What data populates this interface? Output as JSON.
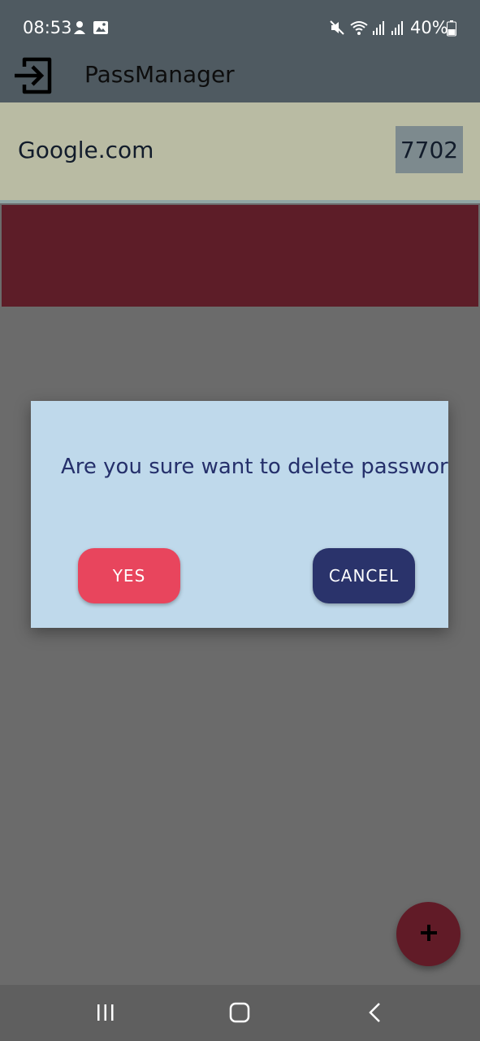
{
  "status_bar": {
    "time": "08:53",
    "battery": "40%",
    "icons": [
      "notification-icon",
      "gallery-icon",
      "mute-icon",
      "wifi-icon",
      "signal-icon",
      "signal-icon",
      "battery-icon"
    ]
  },
  "app_bar": {
    "title": "PassManager",
    "leading_icon": "exit-icon"
  },
  "list": {
    "items": [
      {
        "site": "Google.com",
        "pin": "7702"
      }
    ]
  },
  "dialog": {
    "message": "Are you sure want to delete password",
    "yes_label": "YES",
    "cancel_label": "CANCEL"
  },
  "fab": {
    "icon": "plus-icon"
  },
  "nav_bar": {
    "icons": [
      "recent-apps-icon",
      "home-icon",
      "back-icon"
    ]
  },
  "colors": {
    "app_bar": "#4f5a61",
    "list_item_bg": "#b9bba3",
    "delete_strip": "#5d1d28",
    "dialog_bg": "#bfd9eb",
    "dialog_text": "#25306b",
    "yes_button": "#e8455d",
    "cancel_button": "#2a336b",
    "fab": "#611b27",
    "scrim": "#6b6b6b"
  }
}
